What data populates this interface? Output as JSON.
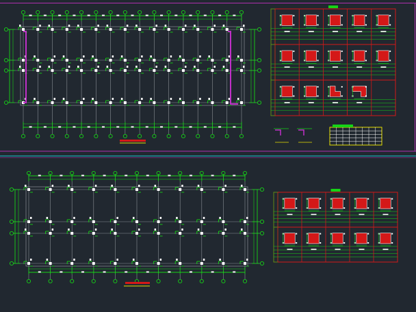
{
  "drawing": {
    "background_color": "#212830",
    "colors": {
      "axis_green": "#16d416",
      "grid_gray": "#8a9096",
      "column_white": "#ffffff",
      "frame_red": "#d41818",
      "sheet_border_magenta": "#b030b0",
      "separator_cyan": "#20c8d8",
      "accent_yellow": "#e8e000",
      "wall_magenta": "#c030c8"
    },
    "sheet_top": {
      "plan": {
        "axis_labels_top": [
          "①",
          "②",
          "③",
          "④",
          "⑤",
          "⑥",
          "⑦",
          "⑧",
          "⑨",
          "⑩",
          "⑪",
          "⑫",
          "⑬",
          "⑭",
          "⑮",
          "⑯"
        ],
        "axis_labels_left": [
          "Ⓐ",
          "Ⓑ",
          "Ⓒ",
          "Ⓓ"
        ]
      },
      "detail_table": {
        "rows": 3,
        "cols": 5,
        "cell_types_row3": [
          "square",
          "square",
          "l-shape",
          "stepped"
        ]
      },
      "legend_table": {
        "rows": 5,
        "cols": 8
      }
    },
    "sheet_bottom": {
      "plan": {
        "axis_labels_top": [
          "①",
          "②",
          "③",
          "④",
          "⑤",
          "⑥",
          "⑦",
          "⑧",
          "⑨",
          "⑩",
          "⑪",
          "⑫",
          "⑬",
          "⑭",
          "⑮",
          "⑯"
        ],
        "axis_labels_left": [
          "Ⓐ",
          "Ⓑ",
          "Ⓒ",
          "Ⓓ"
        ]
      },
      "detail_table": {
        "rows": 2,
        "cols": 5
      }
    }
  }
}
